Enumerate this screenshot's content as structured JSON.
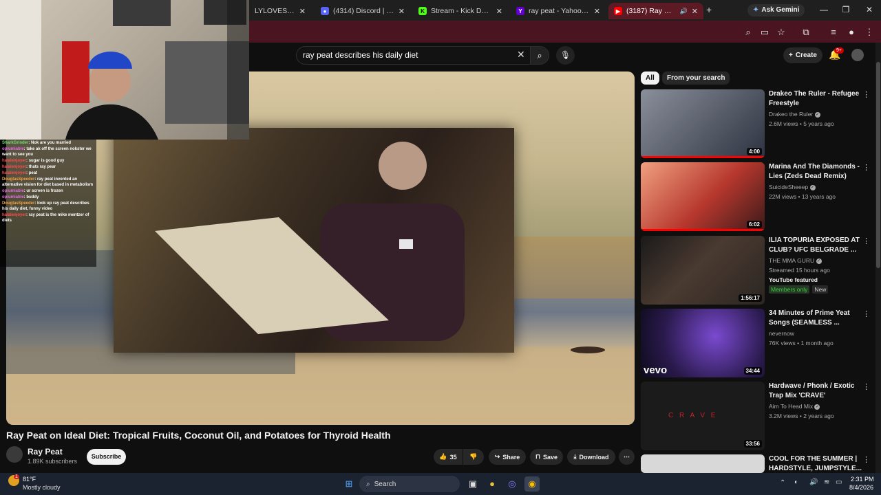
{
  "browser": {
    "tabs": [
      {
        "label": "LYLOVESPEECH",
        "favicon": "web-icon",
        "color": "#3a3a3a"
      },
      {
        "label": "(4314) Discord | #Gene",
        "favicon": "discord-icon",
        "color": "#5865f2"
      },
      {
        "label": "Stream - Kick Dashboa",
        "favicon": "kick-icon",
        "color": "#53fc18"
      },
      {
        "label": "ray peat - Yahoo Searc",
        "favicon": "yahoo-icon",
        "color": "#6001d2"
      },
      {
        "label": "(3187) Ray Peat on",
        "favicon": "youtube-icon",
        "color": "#ff0000"
      }
    ],
    "new_tab": "+",
    "ask_gemini": "Ask Gemini"
  },
  "youtube": {
    "search_query": "ray peat describes his daily diet",
    "create_label": "Create",
    "notification_count": "9+",
    "video": {
      "title": "Ray Peat on Ideal Diet: Tropical Fruits, Coconut Oil, and Potatoes for Thyroid Health",
      "channel": "Ray Peat",
      "subscribers": "1.89K subscribers",
      "subscribe_label": "Subscribe",
      "likes": "35",
      "share_label": "Share",
      "save_label": "Save",
      "download_label": "Download"
    },
    "chips": [
      "All",
      "From your search"
    ],
    "recommendations": [
      {
        "title": "Drakeo The Ruler - Refugee Freestyle",
        "channel": "Drakeo the Ruler",
        "verified": true,
        "meta": "2.6M views • 5 years ago",
        "duration": "4:00",
        "thumb_color": "#2d3340",
        "watched": 1.0
      },
      {
        "title": "Marina And The Diamonds - Lies (Zeds Dead Remix)",
        "channel": "SuicideSheeep",
        "verified": true,
        "meta": "22M views • 13 years ago",
        "duration": "6:02",
        "thumb_color": "#b6372d",
        "watched": 1.0
      },
      {
        "title": "ILIA TOPURIA EXPOSED AT CLUB? UFC BELGRADE ...",
        "channel": "THE MMA GURU",
        "verified": true,
        "meta": "Streamed 15 hours ago",
        "featured": "YouTube featured",
        "members": "Members only",
        "new_badge": "New",
        "duration": "1:56:17",
        "thumb_color": "#2b2622"
      },
      {
        "title": "34 Minutes of Prime Yeat Songs (SEAMLESS ...",
        "channel": "nevernow",
        "verified": false,
        "meta": "76K views • 1 month ago",
        "duration": "34:44",
        "thumb_color": "#2a1a4d",
        "thumb_text": "vevo"
      },
      {
        "title": "Hardwave / Phonk / Exotic Trap Mix 'CRAVE'",
        "channel": "Aim To Head Mix",
        "verified": true,
        "meta": "3.2M views • 2 years ago",
        "duration": "33:56",
        "thumb_color": "#1b1b1b",
        "thumb_text": "C R A V E"
      },
      {
        "title": "COOL FOR THE SUMMER | HARDSTYLE, JUMPSTYLE...",
        "channel": "",
        "verified": false,
        "meta": "",
        "duration": "",
        "thumb_color": "#d8d8d8"
      }
    ]
  },
  "chat": [
    {
      "user": "SharkGrinder",
      "text": "Nok are you married"
    },
    {
      "user": "opiumiable",
      "text": "take ak off the screen nokster we want to see you"
    },
    {
      "user": "halalenjoyer",
      "text": "sugar is good guy"
    },
    {
      "user": "halalenjoyer",
      "text": "thats ray pear"
    },
    {
      "user": "halalenjoyer",
      "text": "peat"
    },
    {
      "user": "DouglasSpeeder",
      "text": "ray peat invented an alternative vision for diet based in metabolism"
    },
    {
      "user": "opiumiable",
      "text": "ur screen is frozen"
    },
    {
      "user": "opiumiable",
      "text": "buddy"
    },
    {
      "user": "DouglasSpeeder",
      "text": "look up ray peat describes his daily diet, funny video"
    },
    {
      "user": "halalenjoyer",
      "text": "ray peat is the mike mentzer of diets"
    }
  ],
  "taskbar": {
    "weather_temp": "81°F",
    "weather_desc": "Mostly cloudy",
    "weather_badge": "1",
    "search_label": "Search",
    "time": "2:31 PM",
    "date": "8/4/2026"
  }
}
